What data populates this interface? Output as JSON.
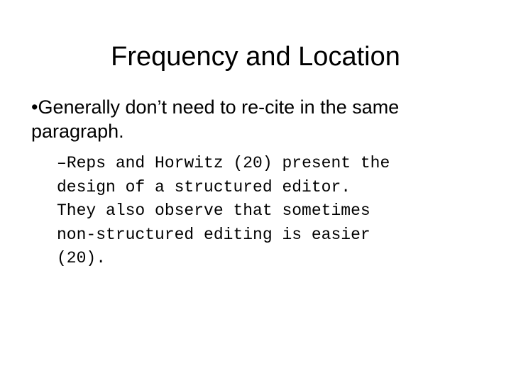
{
  "slide": {
    "title": "Frequency and Location",
    "bullets": [
      {
        "marker": "•",
        "text": "Generally don’t need to re-cite in the same paragraph.",
        "sub_items": [
          {
            "marker": "–",
            "lines": [
              "Reps and Horwitz (20) present the",
              "design of a structured editor.",
              "They also observe that sometimes",
              "non-structured editing is easier",
              "(20)."
            ]
          }
        ]
      }
    ]
  }
}
